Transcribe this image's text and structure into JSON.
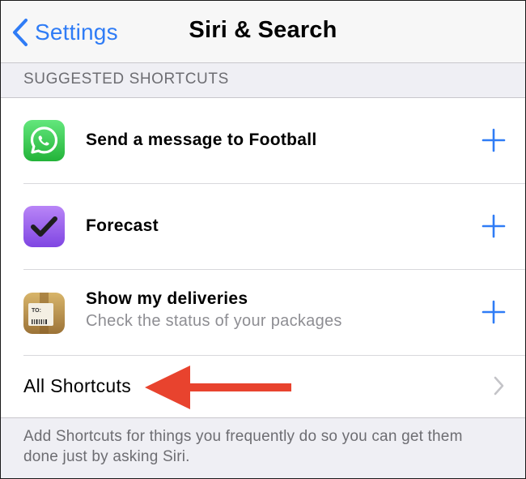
{
  "navbar": {
    "back_label": "Settings",
    "title": "Siri & Search",
    "accent_color": "#2f7cf6"
  },
  "section": {
    "header": "SUGGESTED SHORTCUTS"
  },
  "shortcuts": [
    {
      "title": "Send a message to Football",
      "subtitle": "",
      "icon": "whatsapp-icon",
      "action_icon": "plus-icon"
    },
    {
      "title": "Forecast",
      "subtitle": "",
      "icon": "omnifocus-checkmark-icon",
      "action_icon": "plus-icon"
    },
    {
      "title": "Show my deliveries",
      "subtitle": "Check the status of your packages",
      "icon": "deliveries-package-icon",
      "action_icon": "plus-icon"
    }
  ],
  "all_shortcuts": {
    "label": "All Shortcuts",
    "chevron_icon": "chevron-right-icon"
  },
  "annotation": {
    "arrow_icon": "red-arrow-icon",
    "color": "#e8432e"
  },
  "footer": {
    "text": "Add Shortcuts for things you frequently do so you can get them done just by asking Siri."
  }
}
